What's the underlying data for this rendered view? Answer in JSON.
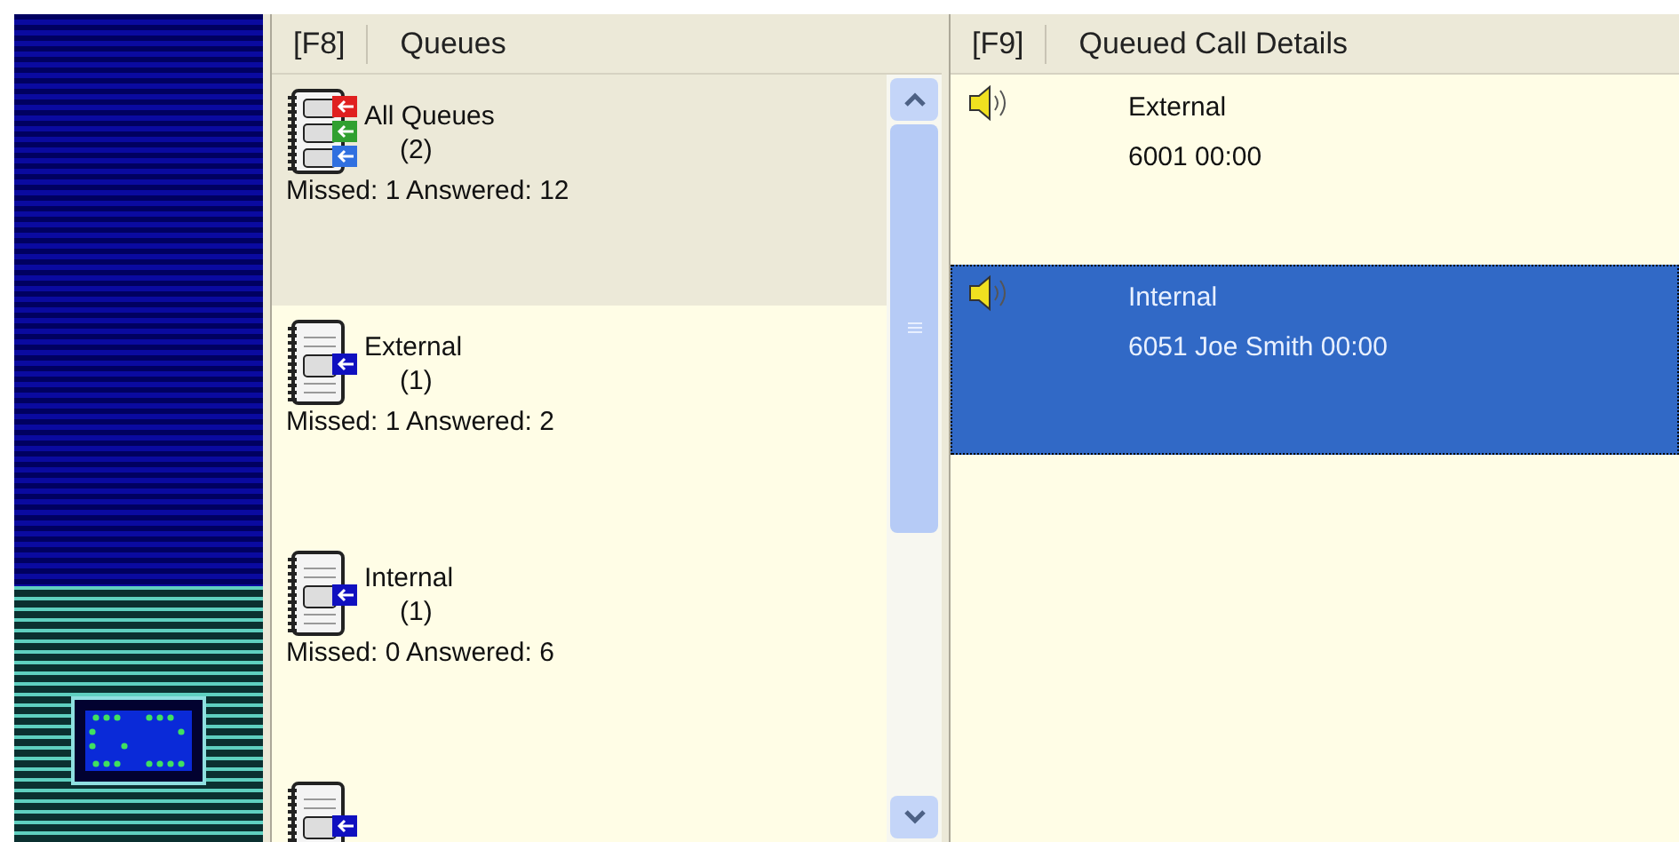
{
  "queues_panel": {
    "hotkey": "[F8]",
    "title": "Queues",
    "items": [
      {
        "kind": "all",
        "name": "All Queues",
        "count": "(2)",
        "stats": "Missed: 1  Answered: 12",
        "selected": true
      },
      {
        "kind": "single",
        "name": "External",
        "count": "(1)",
        "stats": "Missed: 1  Answered: 2",
        "selected": false
      },
      {
        "kind": "single",
        "name": "Internal",
        "count": "(1)",
        "stats": "Missed: 0  Answered: 6",
        "selected": false
      },
      {
        "kind": "single",
        "selected": false
      }
    ]
  },
  "calls_panel": {
    "hotkey": "[F9]",
    "title": "Queued Call Details",
    "items": [
      {
        "queue": "External",
        "details": "6001   00:00",
        "selected": false
      },
      {
        "queue": "Internal",
        "details": "6051 Joe Smith  00:00",
        "selected": true
      }
    ]
  }
}
